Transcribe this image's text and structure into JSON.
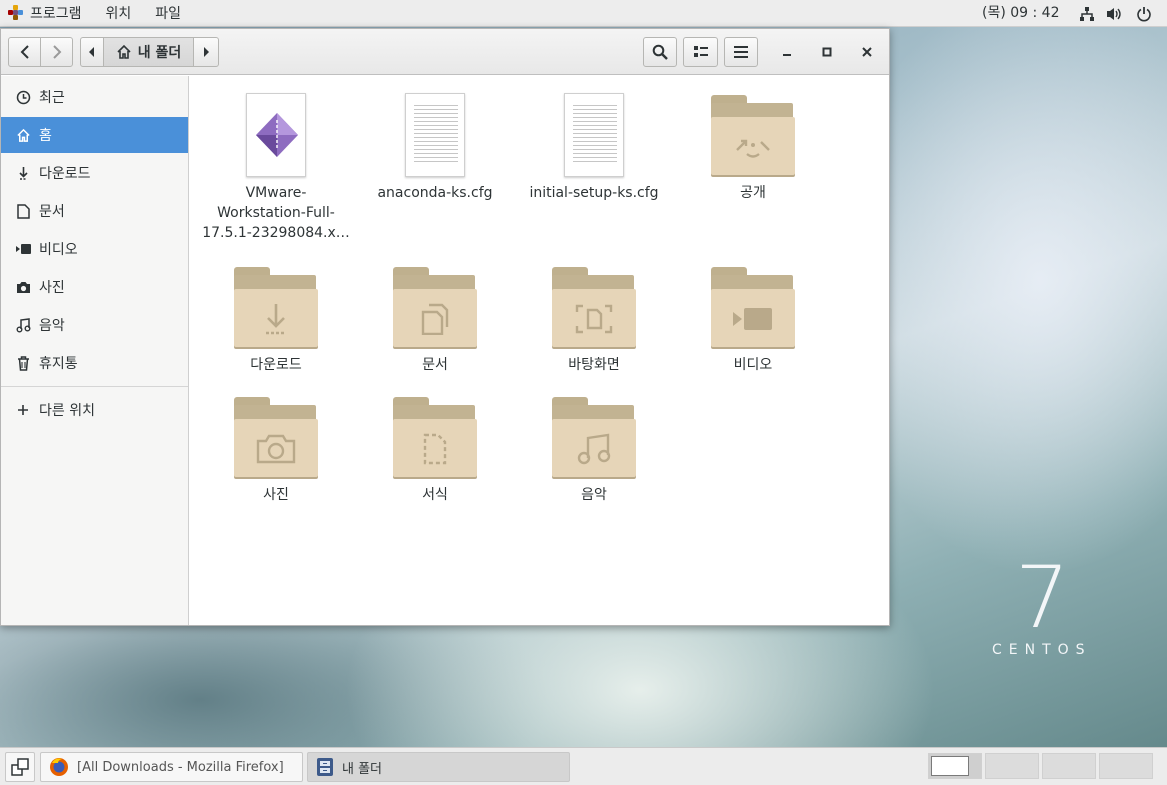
{
  "topbar": {
    "menus": [
      "프로그램",
      "위치",
      "파일"
    ],
    "clock": "(목) 09 : 42"
  },
  "window": {
    "path_label": "내 폴더"
  },
  "sidebar": {
    "items": [
      {
        "label": "최근",
        "icon": "clock-icon"
      },
      {
        "label": "홈",
        "icon": "home-icon"
      },
      {
        "label": "다운로드",
        "icon": "download-icon"
      },
      {
        "label": "문서",
        "icon": "document-icon"
      },
      {
        "label": "비디오",
        "icon": "video-icon"
      },
      {
        "label": "사진",
        "icon": "camera-icon"
      },
      {
        "label": "음악",
        "icon": "music-icon"
      },
      {
        "label": "휴지통",
        "icon": "trash-icon"
      }
    ],
    "other_locations": "다른 위치"
  },
  "files": [
    {
      "name": "VMware-Workstation-Full-17.5.1-23298084.x…",
      "name_lines": [
        "VMware-",
        "Workstation-Full-",
        "17.5.1-23298084.x…"
      ],
      "type": "bundle"
    },
    {
      "name": "anaconda-ks.cfg",
      "type": "text"
    },
    {
      "name": "initial-setup-ks.cfg",
      "type": "text"
    },
    {
      "name": "공개",
      "type": "folder",
      "emblem": "share-icon"
    },
    {
      "name": "다운로드",
      "type": "folder",
      "emblem": "download-icon"
    },
    {
      "name": "문서",
      "type": "folder",
      "emblem": "document-icon"
    },
    {
      "name": "바탕화면",
      "type": "folder",
      "emblem": "desktop-icon"
    },
    {
      "name": "비디오",
      "type": "folder",
      "emblem": "video-icon"
    },
    {
      "name": "사진",
      "type": "folder",
      "emblem": "camera-icon"
    },
    {
      "name": "서식",
      "type": "folder",
      "emblem": "template-icon"
    },
    {
      "name": "음악",
      "type": "folder",
      "emblem": "music-icon"
    }
  ],
  "desktop": {
    "logo_number": "7",
    "logo_word": "CENTOS"
  },
  "taskbar": {
    "tasks": [
      {
        "label": "[All Downloads - Mozilla Firefox]",
        "icon": "firefox-icon"
      },
      {
        "label": "내 폴더",
        "icon": "file-manager-icon"
      }
    ]
  }
}
